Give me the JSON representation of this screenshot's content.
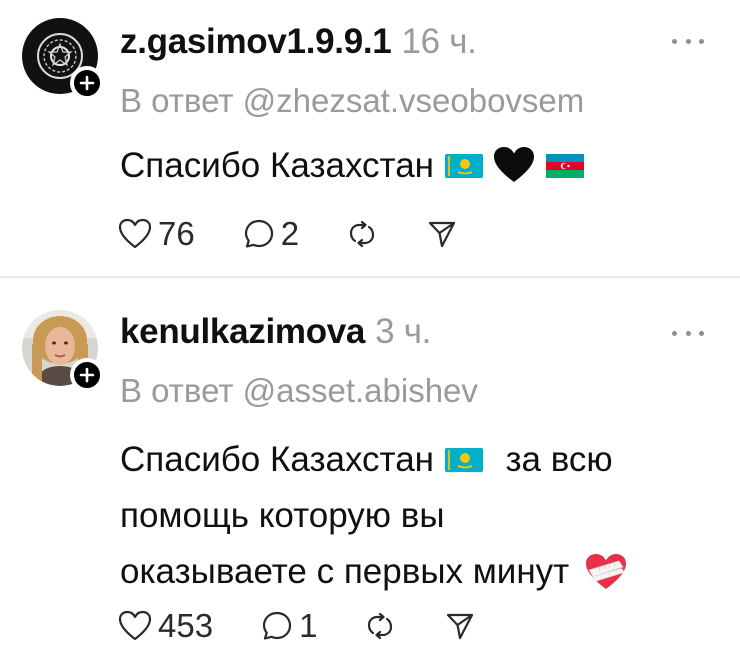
{
  "posts": [
    {
      "username": "z.gasimov1.9.9.1",
      "time": "16 ч.",
      "reply_to": "В ответ @zhezsat.vseobovsem",
      "text_line1": "Спасибо Казахстан",
      "likes": "76",
      "comments": "2",
      "emoji": [
        "flag-kazakhstan",
        "black-heart",
        "flag-azerbaijan"
      ]
    },
    {
      "username": "kenulkazimova",
      "time": "3 ч.",
      "reply_to": "В ответ @asset.abishev",
      "text_line1a": "Спасибо Казахстан",
      "text_line1b": "за всю",
      "text_line2": "помощь которую вы",
      "text_line3": "оказываете с первых минут",
      "likes": "453",
      "comments": "1",
      "emoji": [
        "flag-kazakhstan",
        "mending-heart"
      ]
    }
  ],
  "colors": {
    "text": "#101010",
    "secondary": "#9a9a9a",
    "divider": "#e8e8e8",
    "kz_flag": "#00AFCA",
    "kz_sun": "#FEC50C"
  }
}
